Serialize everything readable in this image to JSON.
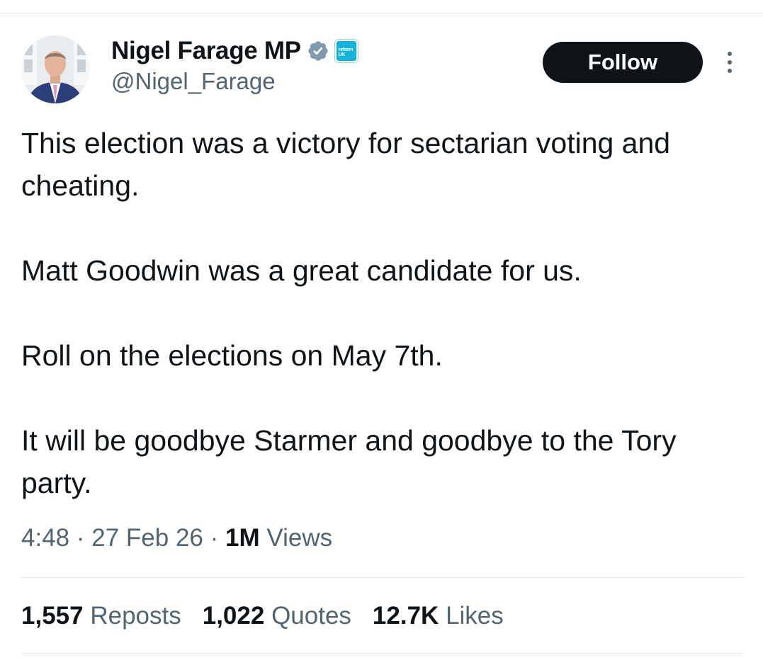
{
  "author": {
    "display_name": "Nigel Farage MP",
    "handle": "@Nigel_Farage",
    "affiliate_badge_text": "reform UK",
    "avatar_icon": "profile-photo",
    "verified_color": "#829aab"
  },
  "actions": {
    "follow_label": "Follow",
    "more_icon": "more-vertical-icon"
  },
  "tweet": {
    "paragraphs": [
      "This election was a victory for sectarian voting and cheating.",
      "Matt Goodwin was a great candidate for us.",
      "Roll on the elections on May 7th.",
      "It will be goodbye Starmer and goodbye to the Tory party."
    ],
    "time": "4:48",
    "date": "27 Feb 26",
    "views_count": "1M",
    "views_label": "Views",
    "separator": "·"
  },
  "stats": {
    "reposts": {
      "count": "1,557",
      "label": "Reposts"
    },
    "quotes": {
      "count": "1,022",
      "label": "Quotes"
    },
    "likes": {
      "count": "12.7K",
      "label": "Likes"
    }
  },
  "colors": {
    "text_primary": "#0f1419",
    "text_secondary": "#536471",
    "divider": "#e6e9eb",
    "follow_bg": "#0f1419",
    "affiliate_bg": "#12b5d9"
  }
}
